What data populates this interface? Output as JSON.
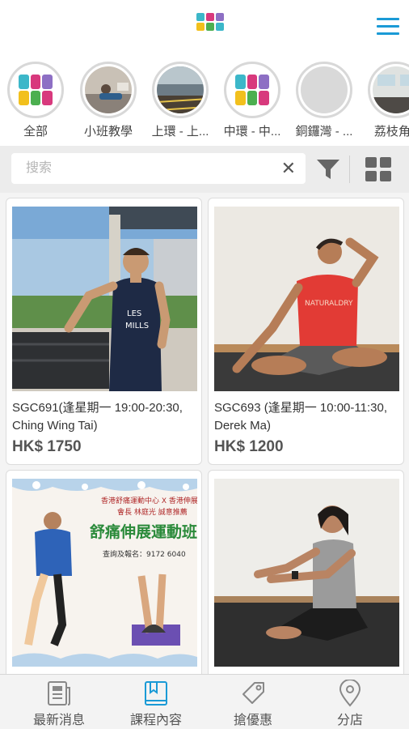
{
  "colors": {
    "accent": "#1a9ad6",
    "logo_teal": "#3cb7c9",
    "logo_magenta": "#d8397d",
    "logo_yellow": "#f2c01d",
    "logo_green": "#4caf50",
    "logo_purple": "#8d6fc4"
  },
  "header": {
    "logo_icon": "org-logo",
    "menu_icon": "hamburger-menu-icon"
  },
  "categories": [
    {
      "label": "全部",
      "icon": "org-logo"
    },
    {
      "label": "小班教學",
      "icon": "class-photo"
    },
    {
      "label": "上環 - 上...",
      "icon": "venue-photo"
    },
    {
      "label": "中環 - 中...",
      "icon": "org-logo"
    },
    {
      "label": "銅鑼灣 - ...",
      "icon": "placeholder"
    },
    {
      "label": "荔枝角 -",
      "icon": "studio-photo"
    }
  ],
  "search": {
    "placeholder": "搜索",
    "clear_icon": "close-icon",
    "filter_icon": "filter-icon",
    "view_icon": "grid-view-icon"
  },
  "products": [
    {
      "title": "SGC691(逢星期一 19:00-20:30, Ching Wing Tai)",
      "price": "HK$ 1750",
      "image": "instructor-stretching-outdoors"
    },
    {
      "title": "SGC693 (逢星期一 10:00-11:30, Derek Ma)",
      "price": "HK$ 1200",
      "image": "instructor-neck-stretch"
    },
    {
      "title": "",
      "price": "",
      "image": "stretching-class-poster",
      "poster": {
        "top": "香港舒痛運動中心 X 香港伸展運動學會",
        "sub": "會長 林庭光 誠意推薦",
        "headline": "舒痛伸展運動班",
        "contact": "查詢及報名：9172 6040"
      }
    },
    {
      "title": "",
      "price": "",
      "image": "woman-seated-stretch"
    }
  ],
  "tabs": [
    {
      "label": "最新消息",
      "icon": "news-icon"
    },
    {
      "label": "課程內容",
      "icon": "book-icon",
      "active": true
    },
    {
      "label": "搶優惠",
      "icon": "tag-icon"
    },
    {
      "label": "分店",
      "icon": "location-pin-icon"
    }
  ]
}
